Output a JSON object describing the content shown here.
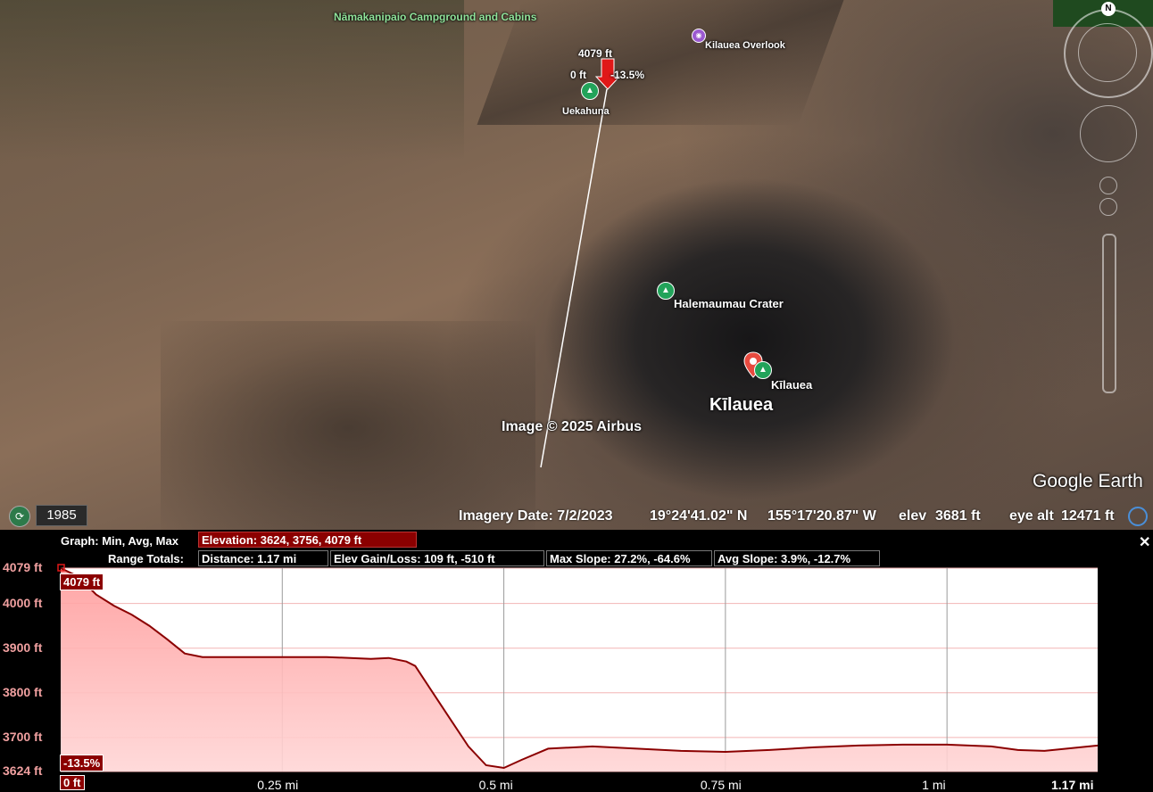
{
  "map": {
    "labels": {
      "campground": "Nāmakanipaio Campground and Cabins",
      "overlook": "Kilauea Overlook",
      "path_elev": "4079 ft",
      "path_dist": "0 ft",
      "path_slope": "-13.5%",
      "uekahuna": "Uekahuna",
      "halemaumau": "Halemaumau Crater",
      "kilauea_small": "Kīlauea",
      "kilauea_big": "Kīlauea",
      "copyright": "Image © 2025 Airbus",
      "watermark": "Google Earth"
    },
    "navigation": {
      "north": "N"
    },
    "status": {
      "year": "1985",
      "imagery_date": "Imagery Date: 7/2/2023",
      "lat": "19°24'41.02\" N",
      "lon": "155°17'20.87\" W",
      "elev_label": "elev",
      "elev_value": "3681 ft",
      "eye_label": "eye alt",
      "eye_value": "12471 ft"
    }
  },
  "profile": {
    "graph_label": "Graph: Min, Avg, Max",
    "elevation_box": "Elevation: 3624, 3756, 4079 ft",
    "range_label": "Range Totals:",
    "distance_box": "Distance: 1.17 mi",
    "gain_box": "Elev Gain/Loss: 109 ft, -510 ft",
    "max_slope_box": "Max Slope: 27.2%, -64.6%",
    "avg_slope_box": "Avg Slope: 3.9%, -12.7%",
    "close": "✕",
    "cursor_elev": "4079 ft",
    "cursor_slope": "-13.5%",
    "cursor_dist": "0 ft"
  },
  "chart_data": {
    "type": "area",
    "xlabel": "",
    "ylabel": "",
    "xlim": [
      0,
      1.17
    ],
    "ylim": [
      3624,
      4079
    ],
    "x_ticks": [
      "0.25 mi",
      "0.5 mi",
      "0.75 mi",
      "1 mi",
      "1.17 mi"
    ],
    "y_ticks": [
      "4079 ft",
      "4000 ft",
      "3900 ft",
      "3800 ft",
      "3700 ft",
      "3624 ft"
    ],
    "y_tick_values": [
      4079,
      4000,
      3900,
      3800,
      3700,
      3624
    ],
    "x_tick_values": [
      0.25,
      0.5,
      0.75,
      1.0,
      1.17
    ],
    "series": [
      {
        "x": [
          0,
          0.02,
          0.04,
          0.06,
          0.08,
          0.1,
          0.12,
          0.14,
          0.16,
          0.2,
          0.25,
          0.3,
          0.35,
          0.37,
          0.39,
          0.4,
          0.42,
          0.44,
          0.46,
          0.48,
          0.5,
          0.52,
          0.55,
          0.6,
          0.65,
          0.7,
          0.75,
          0.8,
          0.85,
          0.9,
          0.95,
          1.0,
          1.05,
          1.08,
          1.11,
          1.14,
          1.17
        ],
        "y": [
          4079,
          4060,
          4020,
          3995,
          3975,
          3950,
          3920,
          3888,
          3880,
          3880,
          3880,
          3880,
          3876,
          3878,
          3870,
          3860,
          3800,
          3740,
          3680,
          3638,
          3632,
          3650,
          3675,
          3680,
          3675,
          3670,
          3668,
          3672,
          3678,
          3682,
          3684,
          3684,
          3680,
          3672,
          3670,
          3676,
          3682
        ]
      }
    ],
    "grid": true
  }
}
